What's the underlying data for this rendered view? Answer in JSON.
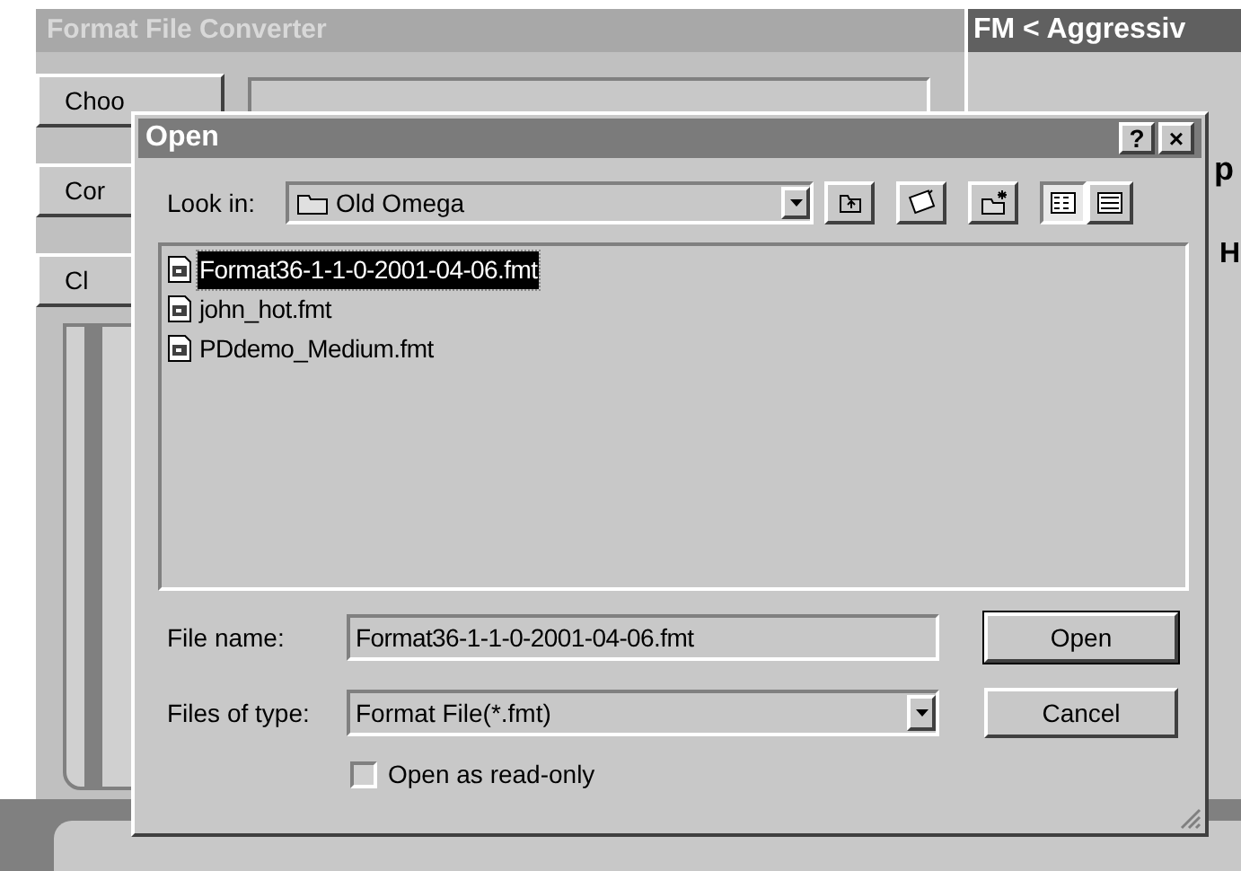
{
  "background_window": {
    "title": "Format File Converter",
    "buttons": [
      "Choo",
      "Cor",
      "Cl"
    ]
  },
  "side_window": {
    "title": "FM < Aggressiv",
    "fragments": [
      "p",
      "H"
    ]
  },
  "dialog": {
    "title": "Open",
    "title_buttons": [
      "?",
      "×"
    ],
    "look_in": {
      "label": "Look in:",
      "value": "Old Omega"
    },
    "files": [
      {
        "name": "Format36-1-1-0-2001-04-06.fmt",
        "selected": true
      },
      {
        "name": "john_hot.fmt",
        "selected": false
      },
      {
        "name": "PDdemo_Medium.fmt",
        "selected": false
      }
    ],
    "file_name": {
      "label": "File name:",
      "value": "Format36-1-1-0-2001-04-06.fmt"
    },
    "file_type": {
      "label": "Files of type:",
      "value": "Format File(*.fmt)"
    },
    "read_only": {
      "label": "Open as read-only",
      "checked": false
    },
    "buttons": [
      {
        "label": "Open",
        "default": true
      },
      {
        "label": "Cancel",
        "default": false
      }
    ]
  }
}
